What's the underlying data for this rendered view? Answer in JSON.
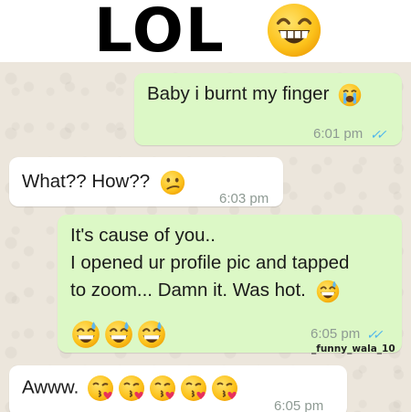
{
  "banner": {
    "title": "LOL",
    "emoji": "grinning-face-with-big-eyes"
  },
  "colors": {
    "chat_background": "#ece6dc",
    "outgoing_bubble": "#dcf8c6",
    "incoming_bubble": "#ffffff",
    "read_ticks": "#4fb6ec",
    "timestamp": "#8e9a93"
  },
  "messages": [
    {
      "direction": "outgoing",
      "text": "Baby i burnt my finger",
      "emojis": [
        "loudly-crying-face"
      ],
      "time": "6:01 pm",
      "status": "✓✓"
    },
    {
      "direction": "incoming",
      "text": "What?? How??",
      "emojis": [
        "confused-face"
      ],
      "time": "6:03 pm"
    },
    {
      "direction": "outgoing",
      "lines": [
        "It's cause of you..",
        "I opened ur profile pic and tapped",
        "to zoom...  Damn it. Was hot."
      ],
      "emojis": [
        "grinning-sweat-face",
        "grinning-sweat-face",
        "grinning-sweat-face",
        "grinning-sweat-face"
      ],
      "time": "6:05 pm",
      "status": "✓✓",
      "watermark": "_funny_wala_10"
    },
    {
      "direction": "incoming",
      "text": "Awww.",
      "emojis": [
        "kissing-heart-face",
        "kissing-heart-face",
        "kissing-heart-face",
        "kissing-heart-face",
        "kissing-heart-face"
      ],
      "time": "6:05 pm"
    }
  ]
}
